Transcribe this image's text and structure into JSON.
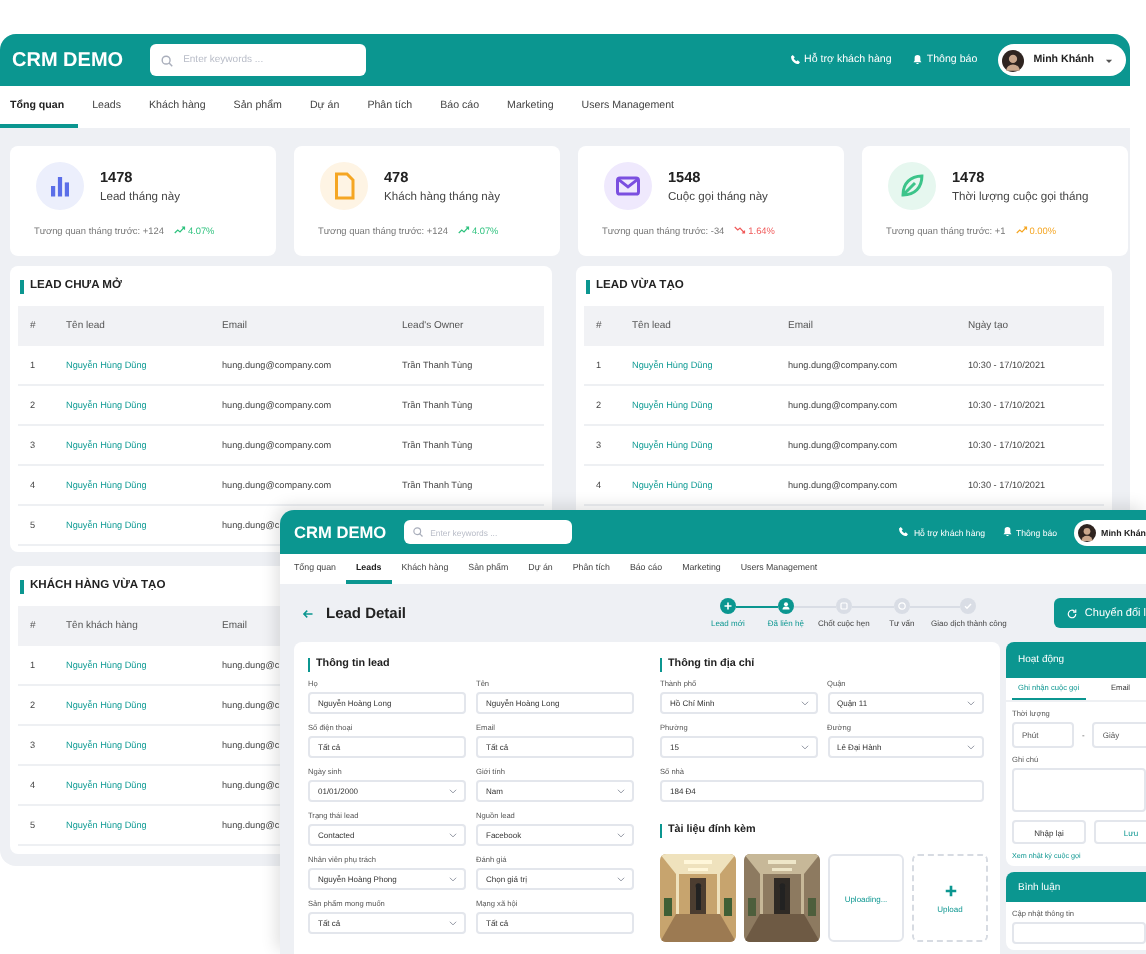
{
  "back_window": {
    "header": {
      "logo": "CRM DEMO",
      "search_placeholder": "Enter keywords ...",
      "support": "Hỗ trợ khách hàng",
      "notifications": "Thông báo",
      "user": "Minh Khánh"
    },
    "tabs": [
      {
        "label": "Tổng quan",
        "selected": true
      },
      {
        "label": "Leads",
        "selected": false
      },
      {
        "label": "Khách hàng",
        "selected": false
      },
      {
        "label": "Sản phẩm",
        "selected": false
      },
      {
        "label": "Dự án",
        "selected": false
      },
      {
        "label": "Phân tích",
        "selected": false
      },
      {
        "label": "Báo cáo",
        "selected": false
      },
      {
        "label": "Marketing",
        "selected": false
      },
      {
        "label": "Users Management",
        "selected": false
      }
    ],
    "stats": [
      {
        "value": "1478",
        "label": "Lead tháng này",
        "compare": "Tương quan tháng trước: +124",
        "change": "4.07%",
        "kind": "up"
      },
      {
        "value": "478",
        "label": "Khách hàng tháng này",
        "compare": "Tương quan tháng trước: +124",
        "change": "4.07%",
        "kind": "up"
      },
      {
        "value": "1548",
        "label": "Cuộc gọi tháng này",
        "compare": "Tương quan tháng trước: -34",
        "change": "1.64%",
        "kind": "down"
      },
      {
        "value": "1478",
        "label": "Thời lượng cuộc gọi tháng",
        "compare": "Tương quan tháng trước: +1",
        "change": "0.00%",
        "kind": "flat"
      }
    ],
    "tables": [
      {
        "title": "LEAD CHƯA MỞ",
        "columns": [
          "#",
          "Tên lead",
          "Email",
          "Lead's Owner"
        ],
        "rows": [
          [
            "1",
            "Nguyễn Hùng Dũng",
            "hung.dung@company.com",
            "Trần Thanh Tùng"
          ],
          [
            "2",
            "Nguyễn Hùng Dũng",
            "hung.dung@company.com",
            "Trần Thanh Tùng"
          ],
          [
            "3",
            "Nguyễn Hùng Dũng",
            "hung.dung@company.com",
            "Trần Thanh Tùng"
          ],
          [
            "4",
            "Nguyễn Hùng Dũng",
            "hung.dung@company.com",
            "Trần Thanh Tùng"
          ],
          [
            "5",
            "Nguyễn Hùng Dũng",
            "hung.dung@c"
          ]
        ]
      },
      {
        "title": "LEAD VỪA TẠO",
        "columns": [
          "#",
          "Tên lead",
          "Email",
          "Ngày tạo"
        ],
        "rows": [
          [
            "1",
            "Nguyễn Hùng Dũng",
            "hung.dung@company.com",
            "10:30 - 17/10/2021"
          ],
          [
            "2",
            "Nguyễn Hùng Dũng",
            "hung.dung@company.com",
            "10:30 - 17/10/2021"
          ],
          [
            "3",
            "Nguyễn Hùng Dũng",
            "hung.dung@company.com",
            "10:30 - 17/10/2021"
          ],
          [
            "4",
            "Nguyễn Hùng Dũng",
            "hung.dung@company.com",
            "10:30 - 17/10/2021"
          ]
        ]
      },
      {
        "title": "KHÁCH HÀNG VỪA TẠO",
        "columns": [
          "#",
          "Tên khách hàng",
          "Email"
        ],
        "rows": [
          [
            "1",
            "Nguyễn Hùng Dũng",
            "hung.dung@c"
          ],
          [
            "2",
            "Nguyễn Hùng Dũng",
            "hung.dung@c"
          ],
          [
            "3",
            "Nguyễn Hùng Dũng",
            "hung.dung@c"
          ],
          [
            "4",
            "Nguyễn Hùng Dũng",
            "hung.dung@c"
          ],
          [
            "5",
            "Nguyễn Hùng Dũng",
            "hung.dung@c"
          ]
        ]
      }
    ]
  },
  "front_window": {
    "header": {
      "logo": "CRM DEMO",
      "search_placeholder": "Enter keywords ...",
      "support": "Hỗ trợ khách hàng",
      "notifications": "Thông báo",
      "user": "Minh Khán"
    },
    "tabs": [
      {
        "label": "Tổng quan",
        "selected": false
      },
      {
        "label": "Leads",
        "selected": true
      },
      {
        "label": "Khách hàng",
        "selected": false
      },
      {
        "label": "Sản phẩm",
        "selected": false
      },
      {
        "label": "Dự án",
        "selected": false
      },
      {
        "label": "Phân tích",
        "selected": false
      },
      {
        "label": "Báo cáo",
        "selected": false
      },
      {
        "label": "Marketing",
        "selected": false
      },
      {
        "label": "Users Management",
        "selected": false
      }
    ],
    "page_title": "Lead Detail",
    "steps": [
      {
        "label": "Lead mới",
        "done": true
      },
      {
        "label": "Đã liên hệ",
        "done": true
      },
      {
        "label": "Chốt cuộc hẹn",
        "done": false
      },
      {
        "label": "Tư vấn",
        "done": false
      },
      {
        "label": "Giao dịch thành công",
        "done": false
      }
    ],
    "convert_button": "Chuyển đổi l",
    "lead_info": {
      "title": "Thông tin lead",
      "fields": [
        {
          "label": "Họ",
          "value": "Nguyễn Hoàng Long",
          "kind": "text"
        },
        {
          "label": "Tên",
          "value": "Nguyễn Hoàng Long",
          "kind": "text"
        },
        {
          "label": "Số điện thoại",
          "value": "Tất cả",
          "kind": "text"
        },
        {
          "label": "Email",
          "value": "Tất cả",
          "kind": "text"
        },
        {
          "label": "Ngày sinh",
          "value": "01/01/2000",
          "kind": "select"
        },
        {
          "label": "Giới tính",
          "value": "Nam",
          "kind": "select"
        },
        {
          "label": "Trạng thái lead",
          "value": "Contacted",
          "kind": "select"
        },
        {
          "label": "Nguồn lead",
          "value": "Facebook",
          "kind": "select"
        },
        {
          "label": "Nhân viên phụ trách",
          "value": "Nguyễn Hoàng Phong",
          "kind": "select"
        },
        {
          "label": "Đánh giá",
          "value": "Chọn giá trị",
          "kind": "select"
        },
        {
          "label": "Sản phẩm mong muốn",
          "value": "Tất cả",
          "kind": "select"
        },
        {
          "label": "Mạng xã hội",
          "value": "Tất cả",
          "kind": "text"
        }
      ]
    },
    "address": {
      "title": "Thông tin địa chỉ",
      "fields": [
        {
          "label": "Thành phố",
          "value": "Hồ Chí Minh",
          "kind": "select"
        },
        {
          "label": "Quận",
          "value": "Quận 11",
          "kind": "select"
        },
        {
          "label": "Phường",
          "value": "15",
          "kind": "select"
        },
        {
          "label": "Đường",
          "value": "Lê Đại Hành",
          "kind": "select"
        },
        {
          "label": "Số nhà",
          "value": "184 Đ4",
          "kind": "wide_text"
        }
      ]
    },
    "attachments": {
      "title": "Tài liệu đính kèm",
      "items": [
        {
          "kind": "picture"
        },
        {
          "kind": "picture"
        },
        {
          "kind": "uploading",
          "label": "Uploading..."
        },
        {
          "kind": "upload",
          "label": "Upload"
        }
      ]
    },
    "activity": {
      "title": "Hoạt động",
      "tabs": [
        {
          "label": "Ghi nhận cuộc gọi",
          "selected": true
        },
        {
          "label": "Email",
          "selected": false
        }
      ],
      "duration_label": "Thời lượng",
      "minutes_placeholder": "Phút",
      "separator": "-",
      "seconds_placeholder": "Giây",
      "note_label": "Ghi chú",
      "reset_button": "Nhập lại",
      "save_button": "Lưu",
      "log_link": "Xem nhật ký cuộc gọi"
    },
    "comments": {
      "title": "Bình luận",
      "label": "Cập nhật thông tin"
    }
  }
}
